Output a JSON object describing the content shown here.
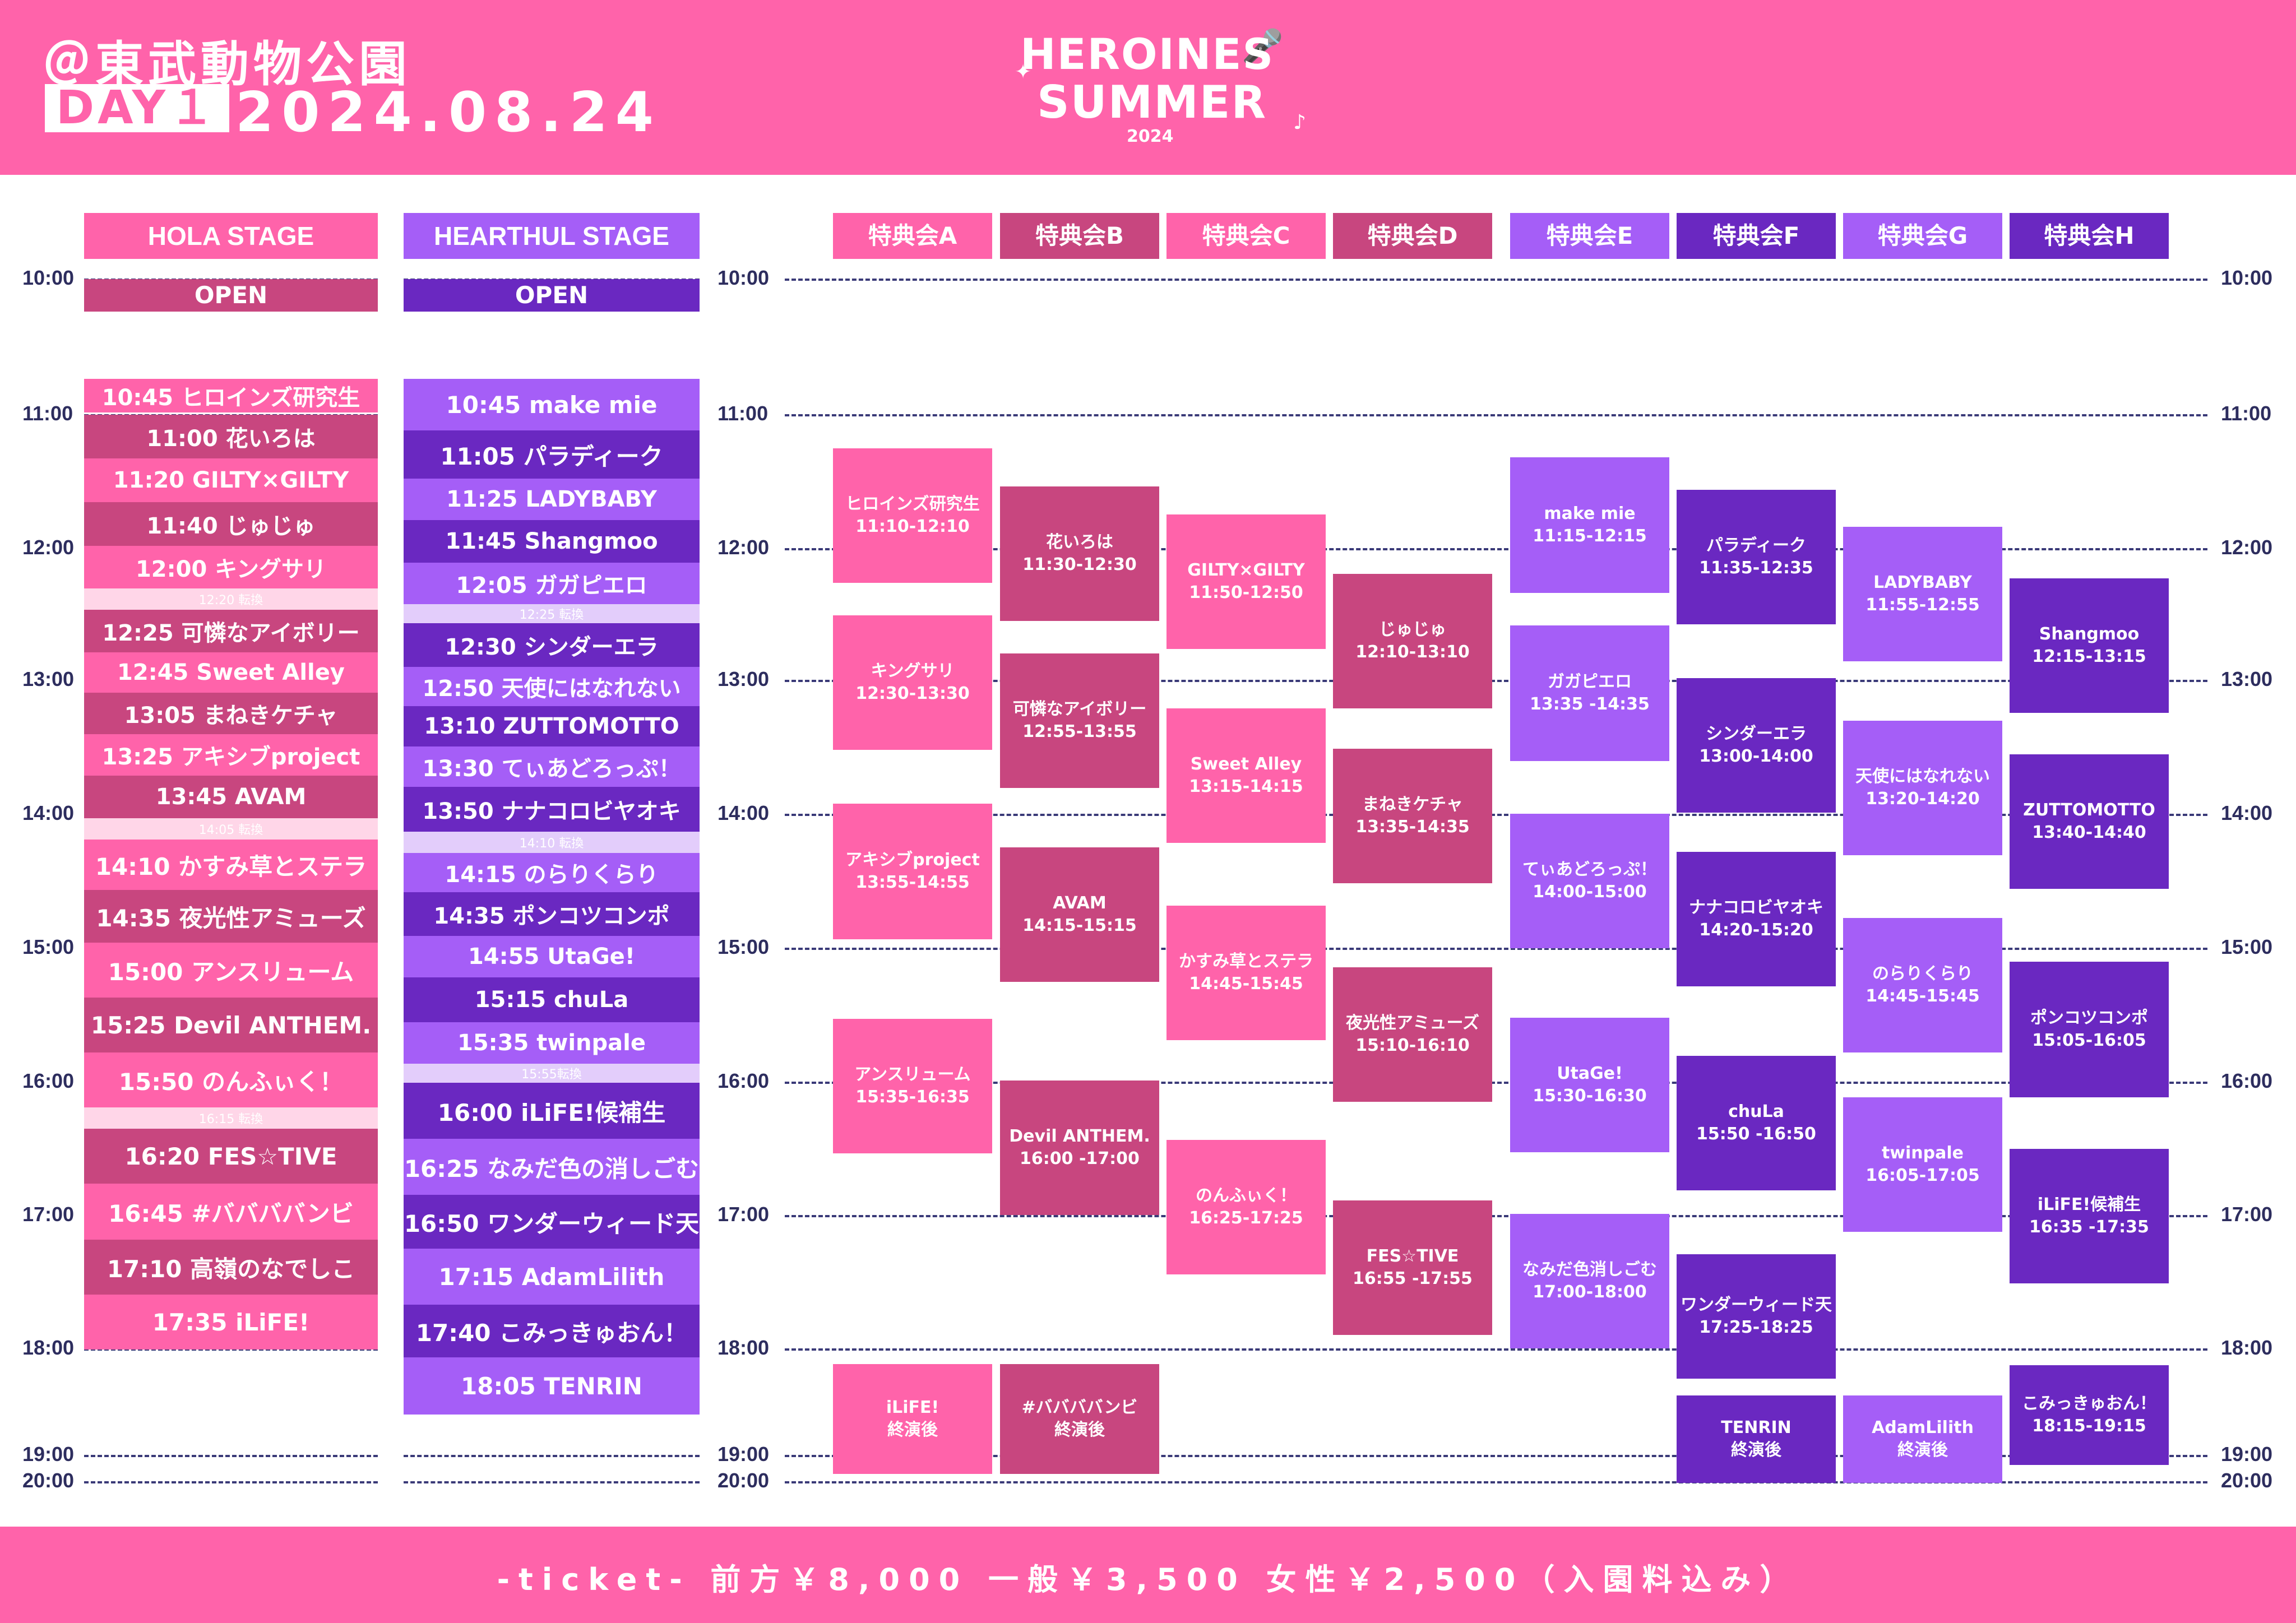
{
  "header": {
    "venue": "＠東武動物公園",
    "day": "DAY１",
    "date": "2024.08.24",
    "logo_line1": "HEROINES",
    "logo_line2": "SUMMER",
    "logo_year": "2024"
  },
  "footer": {
    "ticket": "-ticket- 前方￥8,000 一般￥3,500 女性￥2,500（入園料込み）"
  },
  "colors": {
    "pink": "#ff63aa",
    "rose": "#c8467f",
    "violet": "#a55ef7",
    "purple": "#6a28c1",
    "change_pink": "#ffd6e8",
    "change_purple": "#e3cdfb"
  },
  "time_labels": [
    "10:00",
    "11:00",
    "12:00",
    "13:00",
    "14:00",
    "15:00",
    "16:00",
    "17:00",
    "18:00",
    "19:00",
    "20:00"
  ],
  "hola": {
    "title": "HOLA STAGE",
    "open": "OPEN",
    "slots": [
      {
        "text": "10:45 ヒロインズ研究生",
        "c": "pink"
      },
      {
        "text": "11:00 花いろは",
        "c": "rose"
      },
      {
        "text": "11:20 GILTY×GILTY",
        "c": "pink"
      },
      {
        "text": "11:40 じゅじゅ",
        "c": "rose"
      },
      {
        "text": "12:00 キングサリ",
        "c": "pink"
      },
      {
        "text": "12:20 転換",
        "c": "change"
      },
      {
        "text": "12:25 可憐なアイボリー",
        "c": "rose"
      },
      {
        "text": "12:45 Sweet Alley",
        "c": "pink"
      },
      {
        "text": "13:05 まねきケチャ",
        "c": "rose"
      },
      {
        "text": "13:25 アキシブproject",
        "c": "pink"
      },
      {
        "text": "13:45 AVAM",
        "c": "rose"
      },
      {
        "text": "14:05 転換",
        "c": "change"
      },
      {
        "text": "14:10 かすみ草とステラ",
        "c": "pink"
      },
      {
        "text": "14:35 夜光性アミューズ",
        "c": "rose"
      },
      {
        "text": "15:00 アンスリューム",
        "c": "pink"
      },
      {
        "text": "15:25 Devil ANTHEM.",
        "c": "rose"
      },
      {
        "text": "15:50 のんふぃく！",
        "c": "pink"
      },
      {
        "text": "16:15 転換",
        "c": "change"
      },
      {
        "text": "16:20 FES☆TIVE",
        "c": "rose"
      },
      {
        "text": "16:45 #ババババンビ",
        "c": "pink"
      },
      {
        "text": "17:10 高嶺のなでしこ",
        "c": "rose"
      },
      {
        "text": "17:35 iLiFE!",
        "c": "pink"
      }
    ]
  },
  "hearthul": {
    "title": "HEARTHUL STAGE",
    "open": "OPEN",
    "slots": [
      {
        "text": "10:45 make mie",
        "c": "violet"
      },
      {
        "text": "11:05 パラディーク",
        "c": "purple"
      },
      {
        "text": "11:25 LADYBABY",
        "c": "violet"
      },
      {
        "text": "11:45 Shangmoo",
        "c": "purple"
      },
      {
        "text": "12:05 ガガピエロ",
        "c": "violet"
      },
      {
        "text": "12:25 転換",
        "c": "change"
      },
      {
        "text": "12:30 シンダーエラ",
        "c": "purple"
      },
      {
        "text": "12:50 天使にはなれない",
        "c": "violet"
      },
      {
        "text": "13:10 ZUTTOMOTTO",
        "c": "purple"
      },
      {
        "text": "13:30 てぃあどろっぷ！",
        "c": "violet"
      },
      {
        "text": "13:50 ナナコロビヤオキ",
        "c": "purple"
      },
      {
        "text": "14:10 転換",
        "c": "change"
      },
      {
        "text": "14:15 のらりくらり",
        "c": "violet"
      },
      {
        "text": "14:35 ポンコツコンポ",
        "c": "purple"
      },
      {
        "text": "14:55 UtaGe!",
        "c": "violet"
      },
      {
        "text": "15:15 chuLa",
        "c": "purple"
      },
      {
        "text": "15:35 twinpale",
        "c": "violet"
      },
      {
        "text": "15:55転換",
        "c": "change"
      },
      {
        "text": "16:00 iLiFE!候補生",
        "c": "purple"
      },
      {
        "text": "16:25 なみだ色の消しごむ",
        "c": "violet"
      },
      {
        "text": "16:50 ワンダーウィード天",
        "c": "purple"
      },
      {
        "text": "17:15 AdamLilith",
        "c": "violet"
      },
      {
        "text": "17:40 こみっきゅおん！",
        "c": "purple"
      },
      {
        "text": "18:05 TENRIN",
        "c": "violet"
      }
    ]
  },
  "tokutenkai": [
    {
      "title": "特典会A",
      "c": "pink",
      "items": [
        {
          "name": "ヒロインズ研究生",
          "time": "11:10-12:10"
        },
        {
          "name": "キングサリ",
          "time": "12:30-13:30"
        },
        {
          "name": "アキシブproject",
          "time": "13:55-14:55"
        },
        {
          "name": "アンスリューム",
          "time": "15:35-16:35"
        },
        {
          "name": "iLiFE!",
          "time": "終演後"
        }
      ]
    },
    {
      "title": "特典会B",
      "c": "rose",
      "items": [
        {
          "name": "花いろは",
          "time": "11:30-12:30"
        },
        {
          "name": "可憐なアイボリー",
          "time": "12:55-13:55"
        },
        {
          "name": "AVAM",
          "time": "14:15-15:15"
        },
        {
          "name": "Devil ANTHEM.",
          "time": "16:00 -17:00"
        },
        {
          "name": "#ババババンビ",
          "time": "終演後"
        }
      ]
    },
    {
      "title": "特典会C",
      "c": "pink",
      "items": [
        {
          "name": "GILTY×GILTY",
          "time": "11:50-12:50"
        },
        {
          "name": "Sweet Alley",
          "time": "13:15-14:15"
        },
        {
          "name": "かすみ草とステラ",
          "time": "14:45-15:45"
        },
        {
          "name": "のんふぃく！",
          "time": "16:25-17:25"
        }
      ]
    },
    {
      "title": "特典会D",
      "c": "rose",
      "items": [
        {
          "name": "じゅじゅ",
          "time": "12:10-13:10"
        },
        {
          "name": "まねきケチャ",
          "time": "13:35-14:35"
        },
        {
          "name": "夜光性アミューズ",
          "time": "15:10-16:10"
        },
        {
          "name": "FES☆TIVE",
          "time": "16:55 -17:55"
        }
      ]
    },
    {
      "title": "特典会E",
      "c": "violet",
      "items": [
        {
          "name": "make mie",
          "time": "11:15-12:15"
        },
        {
          "name": "ガガピエロ",
          "time": "13:35 -14:35"
        },
        {
          "name": "てぃあどろっぷ！",
          "time": "14:00-15:00"
        },
        {
          "name": "UtaGe!",
          "time": "15:30-16:30"
        },
        {
          "name": "なみだ色消しごむ",
          "time": "17:00-18:00"
        }
      ]
    },
    {
      "title": "特典会F",
      "c": "purple",
      "items": [
        {
          "name": "パラディーク",
          "time": "11:35-12:35"
        },
        {
          "name": "シンダーエラ",
          "time": "13:00-14:00"
        },
        {
          "name": "ナナコロビヤオキ",
          "time": "14:20-15:20"
        },
        {
          "name": "chuLa",
          "time": "15:50 -16:50"
        },
        {
          "name": "ワンダーウィード天",
          "time": "17:25-18:25"
        },
        {
          "name": "TENRIN",
          "time": "終演後"
        }
      ]
    },
    {
      "title": "特典会G",
      "c": "violet",
      "items": [
        {
          "name": "LADYBABY",
          "time": "11:55-12:55"
        },
        {
          "name": "天使にはなれない",
          "time": "13:20-14:20"
        },
        {
          "name": "のらりくらり",
          "time": "14:45-15:45"
        },
        {
          "name": "twinpale",
          "time": "16:05-17:05"
        },
        {
          "name": "AdamLilith",
          "time": "終演後"
        }
      ]
    },
    {
      "title": "特典会H",
      "c": "purple",
      "items": [
        {
          "name": "Shangmoo",
          "time": "12:15-13:15"
        },
        {
          "name": "ZUTTOMOTTO",
          "time": "13:40-14:40"
        },
        {
          "name": "ポンコツコンポ",
          "time": "15:05-16:05"
        },
        {
          "name": "iLiFE!候補生",
          "time": "16:35 -17:35"
        },
        {
          "name": "こみっきゅおん！",
          "time": "18:15-19:15"
        }
      ]
    }
  ]
}
